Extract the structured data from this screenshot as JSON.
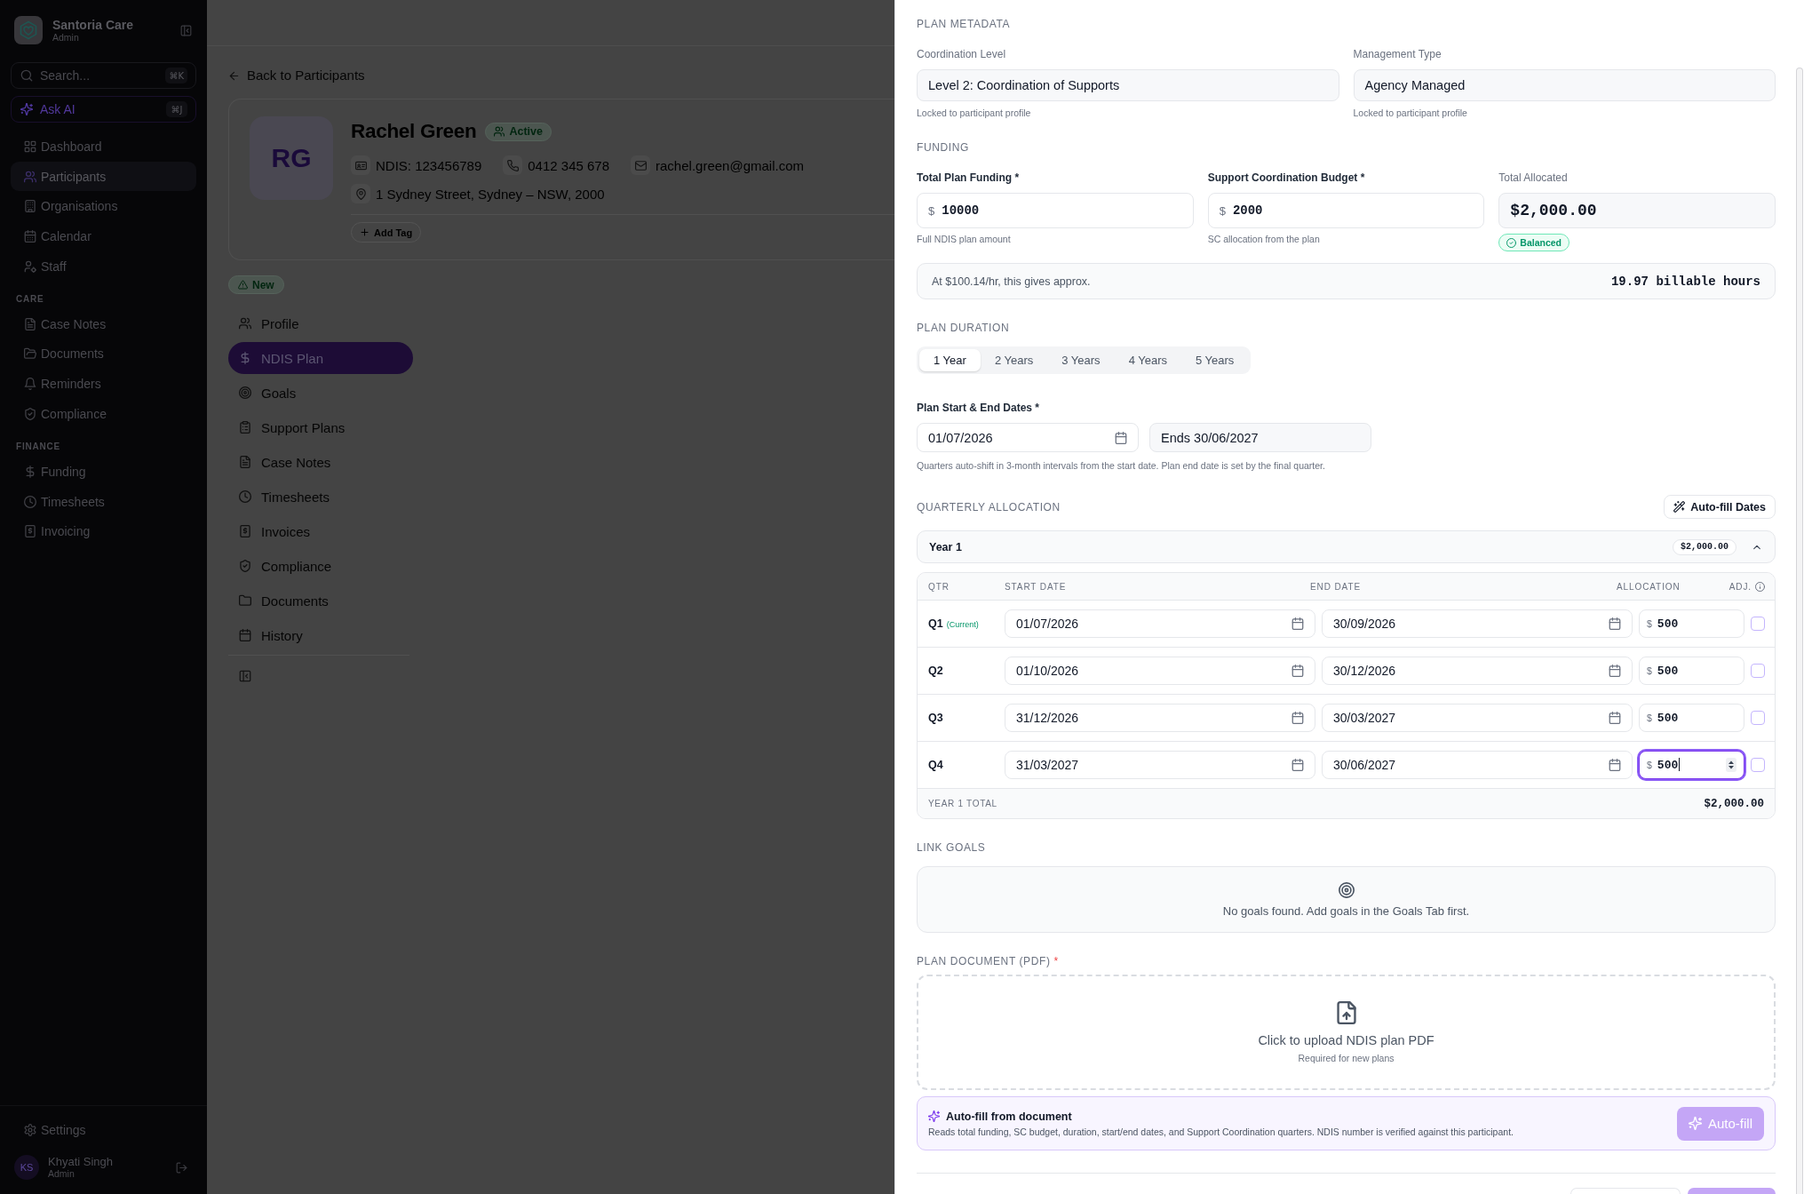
{
  "sidebar": {
    "brand": {
      "name": "Santoria Care",
      "role": "Admin"
    },
    "search": {
      "placeholder": "Search...",
      "shortcut": "⌘K"
    },
    "ask_ai": {
      "label": "Ask AI",
      "shortcut": "⌘J"
    },
    "nav_groups": [
      {
        "items": [
          {
            "label": "Dashboard",
            "selected": false
          },
          {
            "label": "Participants",
            "selected": true
          },
          {
            "label": "Organisations",
            "selected": false
          },
          {
            "label": "Calendar",
            "selected": false
          },
          {
            "label": "Staff",
            "selected": false
          }
        ]
      },
      {
        "heading": "CARE",
        "items": [
          {
            "label": "Case Notes",
            "selected": false
          },
          {
            "label": "Documents",
            "selected": false
          },
          {
            "label": "Reminders",
            "selected": false
          },
          {
            "label": "Compliance",
            "selected": false
          }
        ]
      },
      {
        "heading": "FINANCE",
        "items": [
          {
            "label": "Funding",
            "selected": false
          },
          {
            "label": "Timesheets",
            "selected": false
          },
          {
            "label": "Invoicing",
            "selected": false
          }
        ]
      }
    ],
    "settings": "Settings",
    "user": {
      "initials": "KS",
      "name": "Khyati Singh",
      "role": "Admin"
    }
  },
  "participant_page": {
    "back_link": "Back to Participants",
    "profile": {
      "initials": "RG",
      "name": "Rachel Green",
      "status": "Active",
      "ndis": "NDIS: 123456789",
      "phone": "0412 345 678",
      "email": "rachel.green@gmail.com",
      "address": "1 Sydney Street, Sydney – NSW, 2000",
      "add_tag": "Add Tag"
    },
    "flag": "New",
    "tabs": [
      {
        "label": "Profile",
        "selected": false
      },
      {
        "label": "NDIS Plan",
        "selected": true
      },
      {
        "label": "Goals",
        "selected": false
      },
      {
        "label": "Support Plans",
        "selected": false
      },
      {
        "label": "Case Notes",
        "selected": false
      },
      {
        "label": "Timesheets",
        "selected": false
      },
      {
        "label": "Invoices",
        "selected": false
      },
      {
        "label": "Compliance",
        "selected": false
      },
      {
        "label": "Documents",
        "selected": false
      },
      {
        "label": "History",
        "selected": false
      }
    ]
  },
  "plan_sheet": {
    "plan_metadata": {
      "heading": "PLAN METADATA",
      "fields": [
        {
          "label": "Coordination Level",
          "value": "Level 2: Coordination of Supports",
          "hint": "Locked to participant profile"
        },
        {
          "label": "Management Type",
          "value": "Agency Managed",
          "hint": "Locked to participant profile"
        }
      ]
    },
    "funding": {
      "heading": "FUNDING",
      "fields": [
        {
          "kind": "input",
          "label": "Total Plan Funding *",
          "prefix": "$",
          "value": "10000",
          "hint": "Full NDIS plan amount"
        },
        {
          "kind": "input",
          "label": "Support Coordination Budget *",
          "prefix": "$",
          "value": "2000",
          "hint": "SC allocation from the plan"
        },
        {
          "kind": "total",
          "label": "Total Allocated",
          "value": "$2,000.00",
          "status": "Balanced"
        }
      ],
      "rate_note": "At $100.14/hr, this gives approx.",
      "hours": "19.97 billable hours"
    },
    "plan_duration": {
      "heading": "PLAN DURATION",
      "options": [
        {
          "label": "1 Year",
          "selected": true
        },
        {
          "label": "2 Years",
          "selected": false
        },
        {
          "label": "3 Years",
          "selected": false
        },
        {
          "label": "4 Years",
          "selected": false
        },
        {
          "label": "5 Years",
          "selected": false
        }
      ]
    },
    "plan_dates": {
      "label": "Plan Start & End Dates *",
      "start": "01/07/2026",
      "end": "Ends 30/06/2027",
      "hint": "Quarters auto-shift in 3-month intervals from the start date. Plan end date is set by the final quarter."
    },
    "quarterly_allocation": {
      "heading": "QUARTERLY ALLOCATION",
      "autofill_button": "Auto-fill Dates",
      "years": [
        {
          "title": "Year 1",
          "total": "$2,000.00",
          "expanded": true,
          "columns": [
            "QTR",
            "START DATE",
            "END DATE",
            "ALLOCATION",
            "ADJ."
          ],
          "quarters": [
            {
              "label": "Q1",
              "note": "(Current)",
              "start": "01/07/2026",
              "end": "30/09/2026",
              "prefix": "$",
              "allocation": "500",
              "focused": false,
              "adjusted": false
            },
            {
              "label": "Q2",
              "start": "01/10/2026",
              "end": "30/12/2026",
              "prefix": "$",
              "allocation": "500",
              "focused": false,
              "adjusted": false
            },
            {
              "label": "Q3",
              "start": "31/12/2026",
              "end": "30/03/2027",
              "prefix": "$",
              "allocation": "500",
              "focused": false,
              "adjusted": false
            },
            {
              "label": "Q4",
              "start": "31/03/2027",
              "end": "30/06/2027",
              "prefix": "$",
              "allocation": "500",
              "focused": true,
              "adjusted": false
            }
          ],
          "total_label": "YEAR 1 TOTAL",
          "total_value": "$2,000.00"
        }
      ]
    },
    "link_goals": {
      "heading": "LINK GOALS",
      "empty_text": "No goals found. Add goals in the Goals Tab first."
    },
    "plan_document": {
      "heading": "PLAN DOCUMENT (PDF)",
      "required_mark": "*",
      "upload_text": "Click to upload NDIS plan PDF",
      "upload_hint": "Required for new plans"
    },
    "autofill": {
      "title": "Auto-fill from document",
      "description": "Reads total funding, SC budget, duration, start/end dates, and Support Coordination quarters. NDIS number is verified against this participant.",
      "button": "Auto-fill",
      "disabled": true
    }
  }
}
